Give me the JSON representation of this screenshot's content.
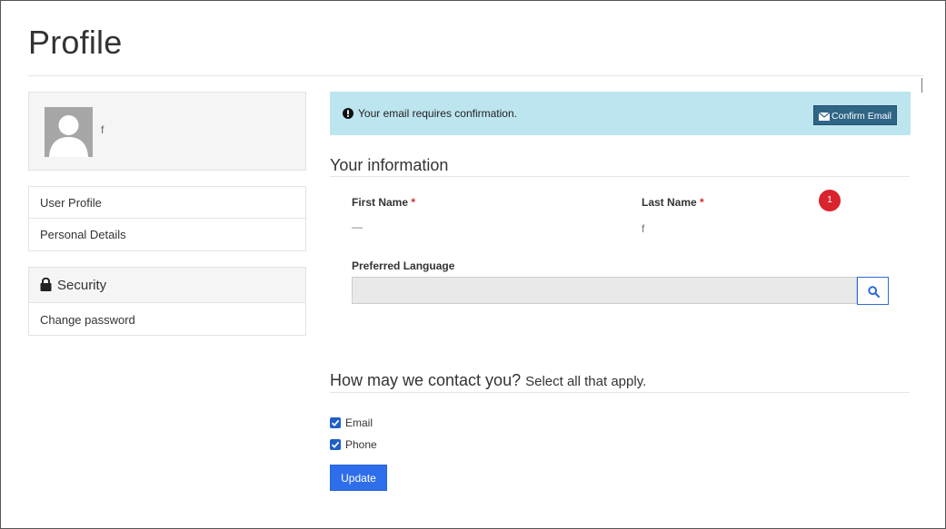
{
  "page": {
    "title": "Profile"
  },
  "sidebar": {
    "profile_name": "f",
    "nav_items": [
      {
        "label": "User Profile"
      },
      {
        "label": "Personal Details"
      }
    ],
    "security": {
      "header": "Security",
      "change_password": "Change password"
    }
  },
  "alert": {
    "message": "Your email requires confirmation.",
    "confirm_button": "Confirm Email",
    "background": "#bde5f0"
  },
  "your_information": {
    "heading": "Your information",
    "first_name": {
      "label": "First Name",
      "required_mark": "*",
      "value": "—"
    },
    "last_name": {
      "label": "Last Name",
      "required_mark": "*",
      "value": "f"
    },
    "badge_count": "1",
    "preferred_language": {
      "label": "Preferred Language",
      "value": ""
    }
  },
  "contact": {
    "heading": "How may we contact you?",
    "subheading": "Select all that apply.",
    "options": [
      {
        "label": "Email",
        "checked": true
      },
      {
        "label": "Phone",
        "checked": true
      }
    ]
  },
  "update_button": "Update",
  "colors": {
    "primary": "#2f6eea",
    "danger_badge": "#d9232d",
    "required": "#d9282f"
  },
  "icons": [
    "lock-icon",
    "exclamation-circle-icon",
    "envelope-icon",
    "search-icon",
    "checkmark-icon",
    "avatar-placeholder-icon"
  ]
}
